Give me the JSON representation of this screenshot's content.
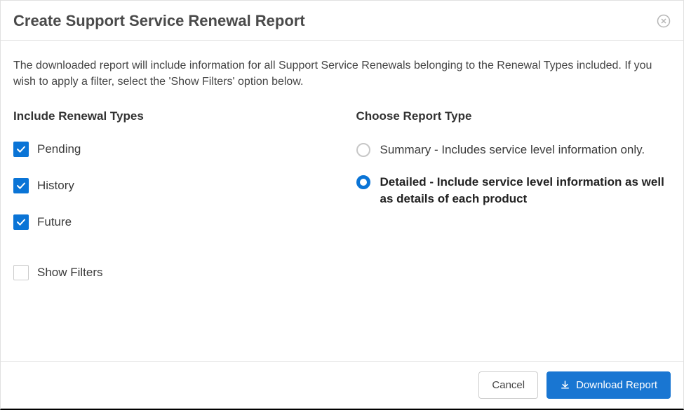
{
  "header": {
    "title": "Create Support Service Renewal Report"
  },
  "intro": "The downloaded report will include information for all Support Service Renewals belonging to the Renewal Types included. If you wish to apply a filter, select the 'Show Filters' option below.",
  "renewalTypes": {
    "heading": "Include Renewal Types",
    "items": [
      {
        "label": "Pending",
        "checked": true
      },
      {
        "label": "History",
        "checked": true
      },
      {
        "label": "Future",
        "checked": true
      }
    ],
    "showFilters": {
      "label": "Show Filters",
      "checked": false
    }
  },
  "reportType": {
    "heading": "Choose Report Type",
    "options": [
      {
        "label": "Summary - Includes service level information only.",
        "selected": false
      },
      {
        "label": "Detailed - Include service level information as well as details of each product",
        "selected": true
      }
    ]
  },
  "footer": {
    "cancel": "Cancel",
    "download": "Download Report"
  }
}
